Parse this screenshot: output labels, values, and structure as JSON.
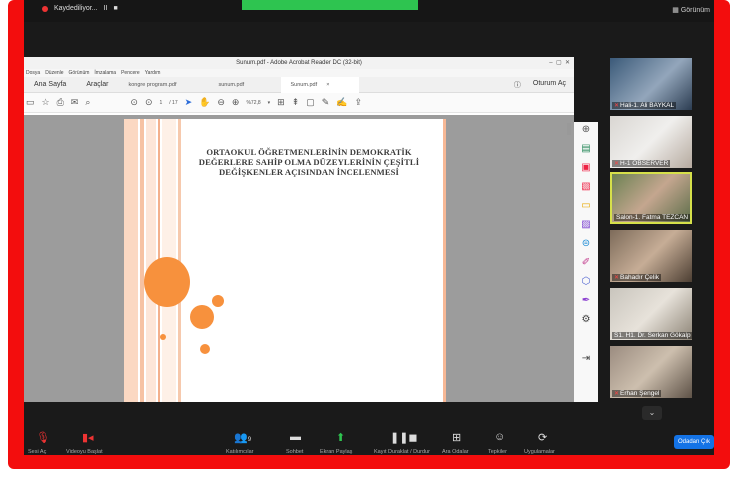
{
  "recording": {
    "label": "Kaydediliyor...",
    "pause": "II",
    "stop": "■"
  },
  "view_label": "Görünüm",
  "acrobat": {
    "window_title": "Sunum.pdf - Adobe Acrobat Reader DC (32-bit)",
    "menu": [
      "Dosya",
      "Düzenle",
      "Görünüm",
      "İmzalama",
      "Pencere",
      "Yardım"
    ],
    "tabs": [
      {
        "label": "Ana Sayfa"
      },
      {
        "label": "Araçlar"
      },
      {
        "label": "kongre program.pdf"
      },
      {
        "label": "sunum.pdf"
      },
      {
        "label": "Sunum.pdf"
      }
    ],
    "close_tab": "×",
    "signin": "Oturum Aç",
    "page_current": "1",
    "page_total": "/ 17",
    "zoom": "%72,8"
  },
  "slide": {
    "title_lines": [
      "ORTAOKUL ÖĞRETMENLERİNİN DEMOKRATİK",
      "DEĞERLERE SAHİP OLMA DÜZEYLERİNİN ÇEŞİTLİ",
      "DEĞİŞKENLER AÇISINDAN İNCELENMESİ"
    ],
    "accent_color": "#f7913d"
  },
  "participants": [
    {
      "name": "Hali-1. Ali BAYKAL",
      "muted": true
    },
    {
      "name": "H-1 OBSERVER",
      "muted": true
    },
    {
      "name": "Salon-1. Fatma TEZCAN",
      "muted": false,
      "active_speaker": true
    },
    {
      "name": "Bahadır Çelik",
      "muted": true
    },
    {
      "name": "S1. H1. Dr. Serkan Gökalp",
      "muted": false
    },
    {
      "name": "Erhan Şengel",
      "muted": true
    }
  ],
  "bottom_bar": {
    "items": [
      {
        "label": "Sesi Aç"
      },
      {
        "label": "Videoyu Başlat"
      },
      {
        "label": "Katılımcılar",
        "count": "9"
      },
      {
        "label": "Sohbet"
      },
      {
        "label": "Ekran Paylaş"
      },
      {
        "label": "Kayıt Duraklat / Durdur"
      },
      {
        "label": "Ara Odalar"
      },
      {
        "label": "Tepkiler"
      },
      {
        "label": "Uygulamalar"
      }
    ],
    "leave": "Odadan Çık"
  }
}
